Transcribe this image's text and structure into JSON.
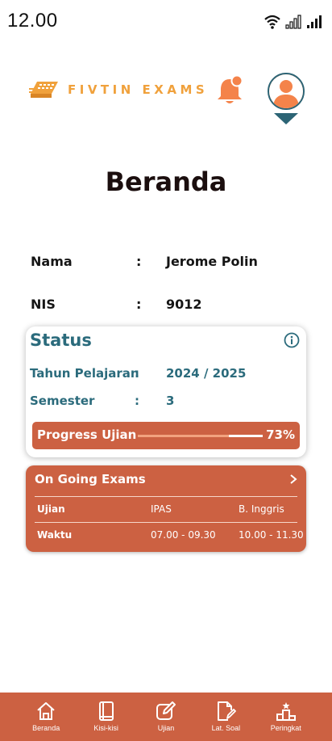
{
  "status_bar": {
    "time": "12.00"
  },
  "header": {
    "brand": "FIVTIN EXAMS"
  },
  "page": {
    "title": "Beranda"
  },
  "profile": [
    {
      "label": "Nama",
      "value": "Jerome Polin"
    },
    {
      "label": "NIS",
      "value": "9012"
    }
  ],
  "status": {
    "title": "Status",
    "rows": [
      {
        "label": "Tahun Pelajaran",
        "value": "2024 / 2025"
      },
      {
        "label": "Semester",
        "value": "3"
      }
    ],
    "progress": {
      "label": "Progress Ujian",
      "value_text": "73%",
      "percent": 73
    }
  },
  "ongoing": {
    "title": "On Going Exams",
    "row_labels": [
      "Ujian",
      "Waktu"
    ],
    "exams": [
      {
        "subject": "IPAS",
        "time": "07.00 - 09.30"
      },
      {
        "subject": "B. Inggris",
        "time": "10.00 - 11.30"
      }
    ]
  },
  "nav": [
    {
      "label": "Beranda",
      "icon": "home-icon"
    },
    {
      "label": "Kisi-kisi",
      "icon": "book-icon"
    },
    {
      "label": "Ujian",
      "icon": "edit-icon"
    },
    {
      "label": "Lat. Soal",
      "icon": "document-edit-icon"
    },
    {
      "label": "Peringkat",
      "icon": "podium-icon"
    }
  ],
  "colors": {
    "primary": "#cc6142",
    "teal": "#2b6b7c",
    "brand": "#f0a13c",
    "accent": "#f4834a"
  },
  "colon": ":"
}
